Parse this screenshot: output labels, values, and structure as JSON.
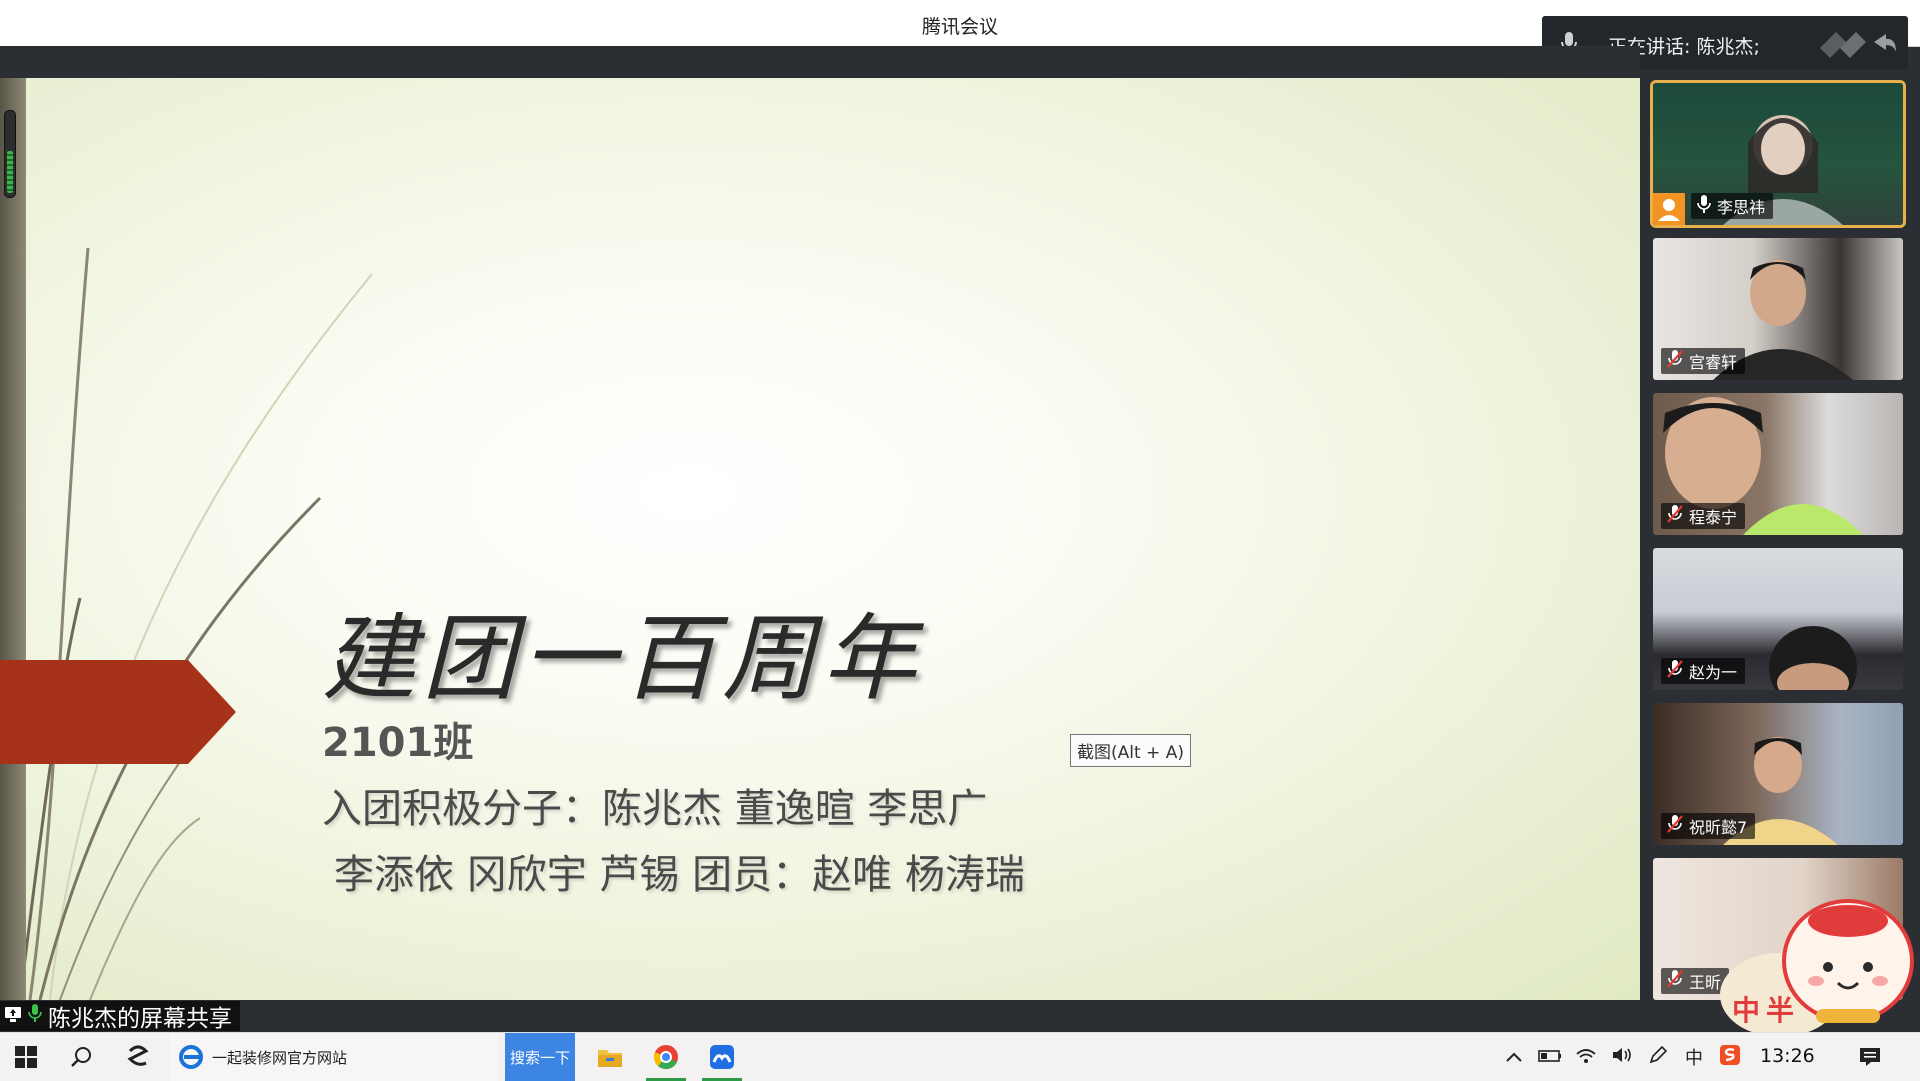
{
  "app": {
    "title": "腾讯会议"
  },
  "speaker": {
    "text": "正在讲话: 陈兆杰;"
  },
  "slide": {
    "title": "建团一百周年",
    "class": "2101班",
    "line1": "入团积极分子：陈兆杰 董逸暄 李思广",
    "line2": "李添依 冈欣宇 芦锡 团员：赵唯 杨涛瑞"
  },
  "tooltip": "截图(Alt + A)",
  "participants": [
    {
      "name": "李思祎",
      "mic": "on",
      "host": true
    },
    {
      "name": "宫睿轩",
      "mic": "muted"
    },
    {
      "name": "程泰宁",
      "mic": "muted"
    },
    {
      "name": "赵为一",
      "mic": "muted"
    },
    {
      "name": "祝昕懿7",
      "mic": "muted"
    },
    {
      "name": "王昕",
      "mic": "muted"
    }
  ],
  "share": {
    "label": "陈兆杰的屏幕共享"
  },
  "taskbar": {
    "browser_tab": "一起装修网官方网站",
    "search_button": "搜索一下",
    "ime": "中",
    "clock": "13:26"
  },
  "sticker": {
    "text": "中半"
  },
  "colors": {
    "accent_host": "#f29324",
    "arrow": "#a7321a",
    "running": "#2f9a48"
  }
}
